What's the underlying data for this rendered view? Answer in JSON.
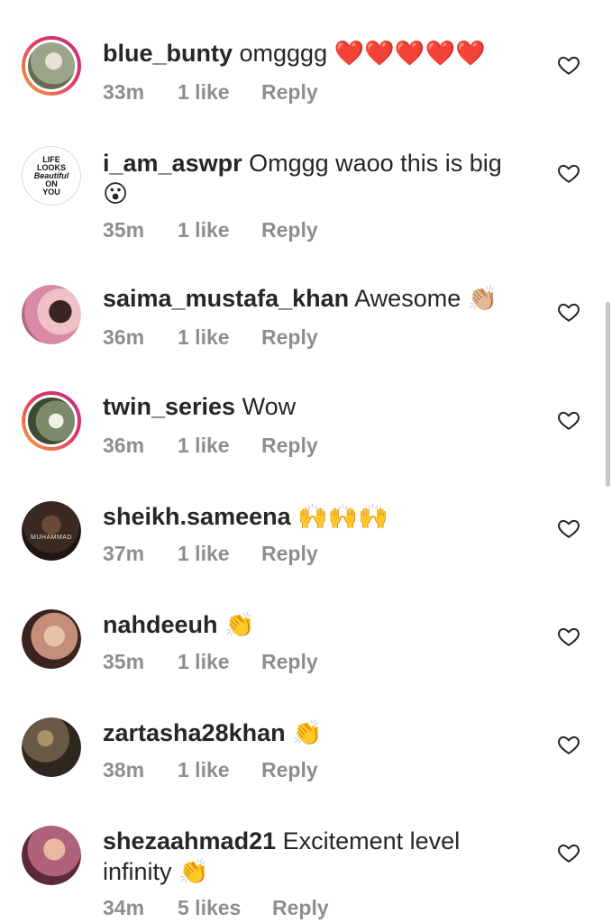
{
  "comments": [
    {
      "username": "blue_bunty",
      "text": " omgggg ",
      "emoji": "❤️❤️❤️❤️❤️",
      "time": "33m",
      "likes": "1 like",
      "reply": "Reply",
      "avatar_color": "#9aa58a",
      "ring": true
    },
    {
      "username": "i_am_aswpr",
      "text": " Omggg waoo this is big",
      "emoji": "😮",
      "time": "35m",
      "likes": "1 like",
      "reply": "Reply",
      "avatar_color": "#ffffff",
      "avatar_text": "LIFE LOOKS Beautiful ON YOU",
      "ring": false
    },
    {
      "username": "saima_mustafa_khan",
      "text": " Awesome ",
      "emoji": "👏🏼",
      "time": "36m",
      "likes": "1 like",
      "reply": "Reply",
      "avatar_color": "#d98aa6",
      "ring": false
    },
    {
      "username": "twin_series",
      "text": " Wow",
      "emoji": "",
      "time": "36m",
      "likes": "1 like",
      "reply": "Reply",
      "avatar_color": "#7a8a6a",
      "ring": true
    },
    {
      "username": "sheikh.sameena",
      "text": " ",
      "emoji": "🙌🙌🙌",
      "time": "37m",
      "likes": "1 like",
      "reply": "Reply",
      "avatar_color": "#3a2a22",
      "avatar_text": "MUHAMMAD",
      "ring": false
    },
    {
      "username": "nahdeeuh",
      "text": " ",
      "emoji": "👏",
      "time": "35m",
      "likes": "1 like",
      "reply": "Reply",
      "avatar_color": "#c48f7a",
      "ring": false
    },
    {
      "username": "zartasha28khan",
      "text": " ",
      "emoji": "👏",
      "time": "38m",
      "likes": "1 like",
      "reply": "Reply",
      "avatar_color": "#4a3f35",
      "ring": false
    },
    {
      "username": "shezaahmad21",
      "text": " Excitement level infinity ",
      "emoji": "👏",
      "time": "34m",
      "likes": "5 likes",
      "reply": "Reply",
      "avatar_color": "#b0627a",
      "ring": false
    }
  ],
  "icons": {
    "like": "heart-outline-icon"
  },
  "colors": {
    "text": "#262626",
    "meta": "#8e8e8e",
    "heart": "#262626"
  }
}
